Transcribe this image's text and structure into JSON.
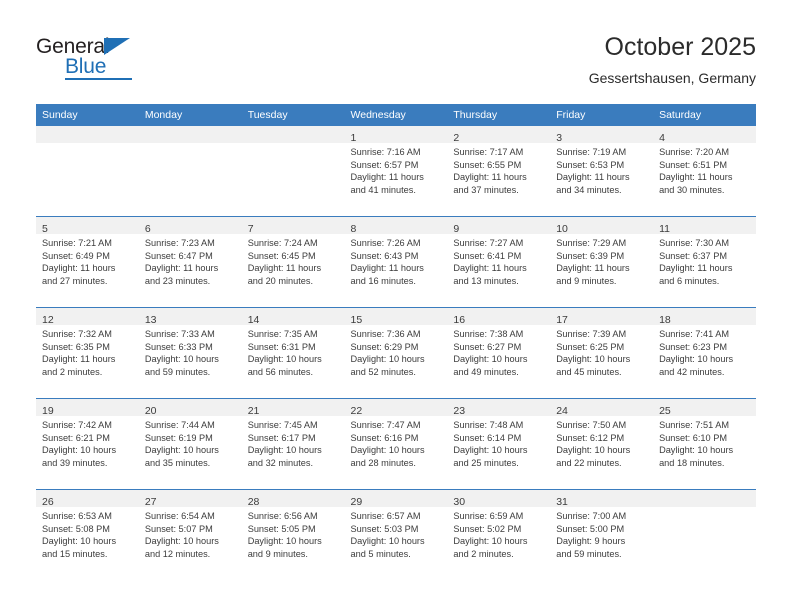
{
  "brand": {
    "name_part1": "General",
    "name_part2": "Blue",
    "accent_color": "#1f6fb5"
  },
  "header": {
    "title": "October 2025",
    "subtitle": "Gessertshausen, Germany"
  },
  "calendar": {
    "header_color": "#3a7cbe",
    "day_band_color": "#f1f1f1",
    "weekday_headers": [
      "Sunday",
      "Monday",
      "Tuesday",
      "Wednesday",
      "Thursday",
      "Friday",
      "Saturday"
    ],
    "weeks": [
      [
        {
          "day": "",
          "sunrise": "",
          "sunset": "",
          "daylight1": "",
          "daylight2": ""
        },
        {
          "day": "",
          "sunrise": "",
          "sunset": "",
          "daylight1": "",
          "daylight2": ""
        },
        {
          "day": "",
          "sunrise": "",
          "sunset": "",
          "daylight1": "",
          "daylight2": ""
        },
        {
          "day": "1",
          "sunrise": "Sunrise: 7:16 AM",
          "sunset": "Sunset: 6:57 PM",
          "daylight1": "Daylight: 11 hours",
          "daylight2": "and 41 minutes."
        },
        {
          "day": "2",
          "sunrise": "Sunrise: 7:17 AM",
          "sunset": "Sunset: 6:55 PM",
          "daylight1": "Daylight: 11 hours",
          "daylight2": "and 37 minutes."
        },
        {
          "day": "3",
          "sunrise": "Sunrise: 7:19 AM",
          "sunset": "Sunset: 6:53 PM",
          "daylight1": "Daylight: 11 hours",
          "daylight2": "and 34 minutes."
        },
        {
          "day": "4",
          "sunrise": "Sunrise: 7:20 AM",
          "sunset": "Sunset: 6:51 PM",
          "daylight1": "Daylight: 11 hours",
          "daylight2": "and 30 minutes."
        }
      ],
      [
        {
          "day": "5",
          "sunrise": "Sunrise: 7:21 AM",
          "sunset": "Sunset: 6:49 PM",
          "daylight1": "Daylight: 11 hours",
          "daylight2": "and 27 minutes."
        },
        {
          "day": "6",
          "sunrise": "Sunrise: 7:23 AM",
          "sunset": "Sunset: 6:47 PM",
          "daylight1": "Daylight: 11 hours",
          "daylight2": "and 23 minutes."
        },
        {
          "day": "7",
          "sunrise": "Sunrise: 7:24 AM",
          "sunset": "Sunset: 6:45 PM",
          "daylight1": "Daylight: 11 hours",
          "daylight2": "and 20 minutes."
        },
        {
          "day": "8",
          "sunrise": "Sunrise: 7:26 AM",
          "sunset": "Sunset: 6:43 PM",
          "daylight1": "Daylight: 11 hours",
          "daylight2": "and 16 minutes."
        },
        {
          "day": "9",
          "sunrise": "Sunrise: 7:27 AM",
          "sunset": "Sunset: 6:41 PM",
          "daylight1": "Daylight: 11 hours",
          "daylight2": "and 13 minutes."
        },
        {
          "day": "10",
          "sunrise": "Sunrise: 7:29 AM",
          "sunset": "Sunset: 6:39 PM",
          "daylight1": "Daylight: 11 hours",
          "daylight2": "and 9 minutes."
        },
        {
          "day": "11",
          "sunrise": "Sunrise: 7:30 AM",
          "sunset": "Sunset: 6:37 PM",
          "daylight1": "Daylight: 11 hours",
          "daylight2": "and 6 minutes."
        }
      ],
      [
        {
          "day": "12",
          "sunrise": "Sunrise: 7:32 AM",
          "sunset": "Sunset: 6:35 PM",
          "daylight1": "Daylight: 11 hours",
          "daylight2": "and 2 minutes."
        },
        {
          "day": "13",
          "sunrise": "Sunrise: 7:33 AM",
          "sunset": "Sunset: 6:33 PM",
          "daylight1": "Daylight: 10 hours",
          "daylight2": "and 59 minutes."
        },
        {
          "day": "14",
          "sunrise": "Sunrise: 7:35 AM",
          "sunset": "Sunset: 6:31 PM",
          "daylight1": "Daylight: 10 hours",
          "daylight2": "and 56 minutes."
        },
        {
          "day": "15",
          "sunrise": "Sunrise: 7:36 AM",
          "sunset": "Sunset: 6:29 PM",
          "daylight1": "Daylight: 10 hours",
          "daylight2": "and 52 minutes."
        },
        {
          "day": "16",
          "sunrise": "Sunrise: 7:38 AM",
          "sunset": "Sunset: 6:27 PM",
          "daylight1": "Daylight: 10 hours",
          "daylight2": "and 49 minutes."
        },
        {
          "day": "17",
          "sunrise": "Sunrise: 7:39 AM",
          "sunset": "Sunset: 6:25 PM",
          "daylight1": "Daylight: 10 hours",
          "daylight2": "and 45 minutes."
        },
        {
          "day": "18",
          "sunrise": "Sunrise: 7:41 AM",
          "sunset": "Sunset: 6:23 PM",
          "daylight1": "Daylight: 10 hours",
          "daylight2": "and 42 minutes."
        }
      ],
      [
        {
          "day": "19",
          "sunrise": "Sunrise: 7:42 AM",
          "sunset": "Sunset: 6:21 PM",
          "daylight1": "Daylight: 10 hours",
          "daylight2": "and 39 minutes."
        },
        {
          "day": "20",
          "sunrise": "Sunrise: 7:44 AM",
          "sunset": "Sunset: 6:19 PM",
          "daylight1": "Daylight: 10 hours",
          "daylight2": "and 35 minutes."
        },
        {
          "day": "21",
          "sunrise": "Sunrise: 7:45 AM",
          "sunset": "Sunset: 6:17 PM",
          "daylight1": "Daylight: 10 hours",
          "daylight2": "and 32 minutes."
        },
        {
          "day": "22",
          "sunrise": "Sunrise: 7:47 AM",
          "sunset": "Sunset: 6:16 PM",
          "daylight1": "Daylight: 10 hours",
          "daylight2": "and 28 minutes."
        },
        {
          "day": "23",
          "sunrise": "Sunrise: 7:48 AM",
          "sunset": "Sunset: 6:14 PM",
          "daylight1": "Daylight: 10 hours",
          "daylight2": "and 25 minutes."
        },
        {
          "day": "24",
          "sunrise": "Sunrise: 7:50 AM",
          "sunset": "Sunset: 6:12 PM",
          "daylight1": "Daylight: 10 hours",
          "daylight2": "and 22 minutes."
        },
        {
          "day": "25",
          "sunrise": "Sunrise: 7:51 AM",
          "sunset": "Sunset: 6:10 PM",
          "daylight1": "Daylight: 10 hours",
          "daylight2": "and 18 minutes."
        }
      ],
      [
        {
          "day": "26",
          "sunrise": "Sunrise: 6:53 AM",
          "sunset": "Sunset: 5:08 PM",
          "daylight1": "Daylight: 10 hours",
          "daylight2": "and 15 minutes."
        },
        {
          "day": "27",
          "sunrise": "Sunrise: 6:54 AM",
          "sunset": "Sunset: 5:07 PM",
          "daylight1": "Daylight: 10 hours",
          "daylight2": "and 12 minutes."
        },
        {
          "day": "28",
          "sunrise": "Sunrise: 6:56 AM",
          "sunset": "Sunset: 5:05 PM",
          "daylight1": "Daylight: 10 hours",
          "daylight2": "and 9 minutes."
        },
        {
          "day": "29",
          "sunrise": "Sunrise: 6:57 AM",
          "sunset": "Sunset: 5:03 PM",
          "daylight1": "Daylight: 10 hours",
          "daylight2": "and 5 minutes."
        },
        {
          "day": "30",
          "sunrise": "Sunrise: 6:59 AM",
          "sunset": "Sunset: 5:02 PM",
          "daylight1": "Daylight: 10 hours",
          "daylight2": "and 2 minutes."
        },
        {
          "day": "31",
          "sunrise": "Sunrise: 7:00 AM",
          "sunset": "Sunset: 5:00 PM",
          "daylight1": "Daylight: 9 hours",
          "daylight2": "and 59 minutes."
        },
        {
          "day": "",
          "sunrise": "",
          "sunset": "",
          "daylight1": "",
          "daylight2": ""
        }
      ]
    ]
  }
}
